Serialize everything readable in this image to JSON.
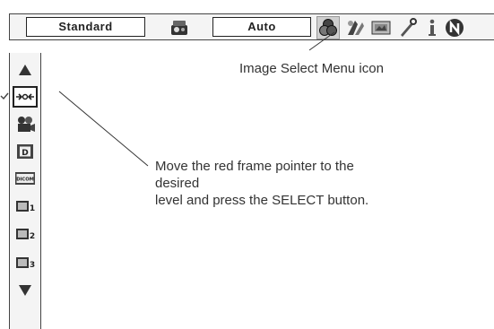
{
  "topbar": {
    "mode_value": "Standard",
    "setting_value": "Auto",
    "icons": [
      "projector-adjust-icon",
      "image-select-icon",
      "image-adjust-icon",
      "screen-icon",
      "setting-wrench-icon",
      "information-icon",
      "network-icon"
    ],
    "selected_icon": "image-select-icon"
  },
  "sidebar": {
    "items": [
      "arrow-up-icon",
      "dynamic-mode-icon",
      "cinema-mode-icon",
      "d-mode-icon",
      "dicom-mode-icon",
      "image-1-icon",
      "image-2-icon",
      "image-3-icon",
      "arrow-down-icon"
    ],
    "selected_item": "dynamic-mode-icon",
    "icon_text": {
      "d": "D",
      "dicom": "DICOM",
      "image1": "1",
      "image2": "2",
      "image3": "3"
    }
  },
  "callouts": {
    "image_select_menu": "Image Select Menu icon",
    "instruction_line1": "Move the red frame pointer to the desired",
    "instruction_line2": "level and press the SELECT button."
  }
}
